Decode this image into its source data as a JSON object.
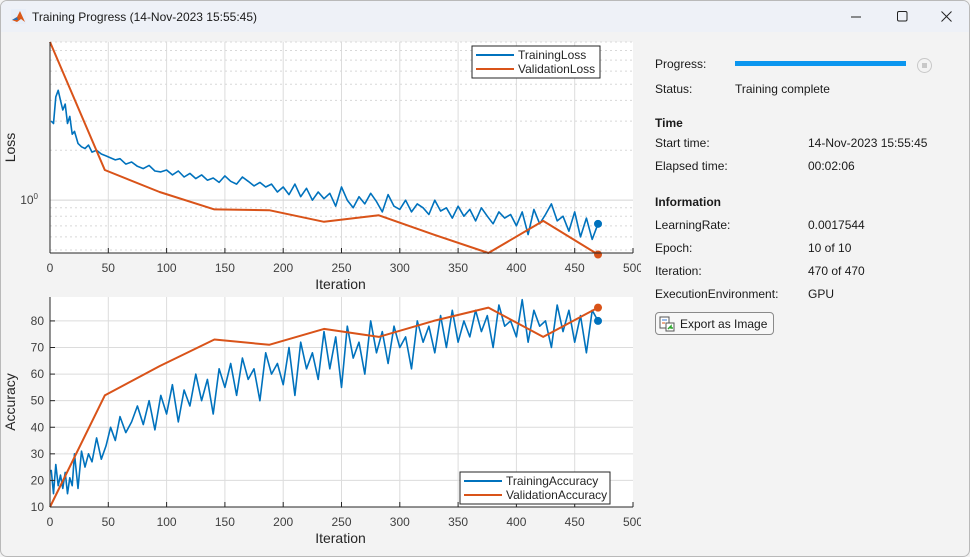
{
  "window": {
    "title": "Training Progress (14-Nov-2023 15:55:45)",
    "controls": [
      "minimize",
      "maximize",
      "close"
    ]
  },
  "panel": {
    "progress_label": "Progress:",
    "progress_fraction": 1.0,
    "status_label": "Status:",
    "status_value": "Training complete",
    "time_heading": "Time",
    "start_time_label": "Start time:",
    "start_time_value": "14-Nov-2023 15:55:45",
    "elapsed_label": "Elapsed time:",
    "elapsed_value": "00:02:06",
    "info_heading": "Information",
    "learning_rate_label": "LearningRate:",
    "learning_rate_value": "0.0017544",
    "epoch_label": "Epoch:",
    "epoch_value": "10 of 10",
    "iteration_label": "Iteration:",
    "iteration_value": "470 of 470",
    "exec_env_label": "ExecutionEnvironment:",
    "exec_env_value": "GPU",
    "export_button_label": "Export as Image"
  },
  "chart_data": [
    {
      "type": "line",
      "title": "",
      "xlabel": "Iteration",
      "ylabel": "Loss",
      "yscale": "log",
      "xlim": [
        0,
        500
      ],
      "ylim": [
        0.48,
        9
      ],
      "xticks": [
        0,
        50,
        100,
        150,
        200,
        250,
        300,
        350,
        400,
        450,
        500
      ],
      "yticks": [
        {
          "value": 1,
          "label": "10",
          "sup": "0"
        }
      ],
      "grid": true,
      "legend": {
        "position": "top-right",
        "entries": [
          "TrainingLoss",
          "ValidationLoss"
        ]
      },
      "series": [
        {
          "name": "TrainingLoss",
          "color": "#0072bd",
          "x": [
            1,
            3,
            5,
            7,
            9,
            11,
            13,
            15,
            17,
            19,
            21,
            24,
            27,
            30,
            33,
            36,
            40,
            44,
            48,
            52,
            56,
            60,
            65,
            70,
            75,
            80,
            85,
            90,
            95,
            100,
            105,
            110,
            115,
            120,
            125,
            130,
            135,
            140,
            145,
            150,
            155,
            160,
            165,
            170,
            175,
            180,
            185,
            190,
            195,
            200,
            205,
            210,
            215,
            220,
            225,
            230,
            235,
            240,
            245,
            250,
            255,
            260,
            265,
            270,
            275,
            280,
            285,
            290,
            295,
            300,
            305,
            310,
            315,
            320,
            325,
            330,
            335,
            340,
            345,
            350,
            355,
            360,
            365,
            370,
            375,
            380,
            385,
            390,
            395,
            400,
            405,
            410,
            415,
            420,
            425,
            430,
            435,
            440,
            445,
            450,
            455,
            460,
            465,
            470
          ],
          "y": [
            3.0,
            2.9,
            4.2,
            4.6,
            4.0,
            3.5,
            3.8,
            2.9,
            3.2,
            2.5,
            2.6,
            2.2,
            2.1,
            2.05,
            2.15,
            1.95,
            2.0,
            1.9,
            1.85,
            1.8,
            1.75,
            1.78,
            1.65,
            1.7,
            1.6,
            1.55,
            1.62,
            1.5,
            1.48,
            1.52,
            1.42,
            1.5,
            1.38,
            1.45,
            1.35,
            1.42,
            1.32,
            1.36,
            1.28,
            1.4,
            1.3,
            1.25,
            1.38,
            1.3,
            1.22,
            1.28,
            1.2,
            1.25,
            1.12,
            1.2,
            1.08,
            1.25,
            1.05,
            1.18,
            1.0,
            1.12,
            1.02,
            1.1,
            0.92,
            1.2,
            1.0,
            0.9,
            1.05,
            0.95,
            1.1,
            0.98,
            0.85,
            1.08,
            0.92,
            0.88,
            1.0,
            0.85,
            0.95,
            0.9,
            0.82,
            1.0,
            0.86,
            0.9,
            0.78,
            0.92,
            0.8,
            0.88,
            0.75,
            0.9,
            0.8,
            0.72,
            0.85,
            0.78,
            0.82,
            0.7,
            0.85,
            0.62,
            0.88,
            0.72,
            0.82,
            0.95,
            0.75,
            0.8,
            0.65,
            0.85,
            0.6,
            0.78,
            0.58,
            0.72
          ]
        },
        {
          "name": "ValidationLoss",
          "color": "#d95319",
          "x": [
            0,
            47,
            94,
            141,
            188,
            235,
            282,
            329,
            376,
            423,
            470
          ],
          "y": [
            9.0,
            1.52,
            1.12,
            0.88,
            0.87,
            0.74,
            0.81,
            0.62,
            0.48,
            0.75,
            0.47
          ]
        }
      ]
    },
    {
      "type": "line",
      "title": "",
      "xlabel": "Iteration",
      "ylabel": "Accuracy",
      "xlim": [
        0,
        500
      ],
      "ylim": [
        10,
        89
      ],
      "xticks": [
        0,
        50,
        100,
        150,
        200,
        250,
        300,
        350,
        400,
        450,
        500
      ],
      "yticks": [
        10,
        20,
        30,
        40,
        50,
        60,
        70,
        80
      ],
      "grid": true,
      "legend": {
        "position": "bottom-right",
        "entries": [
          "TrainingAccuracy",
          "ValidationAccuracy"
        ]
      },
      "series": [
        {
          "name": "TrainingAccuracy",
          "color": "#0072bd",
          "x": [
            1,
            3,
            5,
            7,
            9,
            11,
            13,
            15,
            17,
            19,
            21,
            24,
            27,
            30,
            33,
            36,
            40,
            44,
            48,
            52,
            56,
            60,
            65,
            70,
            75,
            80,
            85,
            90,
            95,
            100,
            105,
            110,
            115,
            120,
            125,
            130,
            135,
            140,
            145,
            150,
            155,
            160,
            165,
            170,
            175,
            180,
            185,
            190,
            195,
            200,
            205,
            210,
            215,
            220,
            225,
            230,
            235,
            240,
            245,
            250,
            255,
            260,
            265,
            270,
            275,
            280,
            285,
            290,
            295,
            300,
            305,
            310,
            315,
            320,
            325,
            330,
            335,
            340,
            345,
            350,
            355,
            360,
            365,
            370,
            375,
            380,
            385,
            390,
            395,
            400,
            405,
            410,
            415,
            420,
            425,
            430,
            435,
            440,
            445,
            450,
            455,
            460,
            465,
            470
          ],
          "y": [
            24,
            15,
            26,
            18,
            22,
            17,
            23,
            15,
            21,
            18,
            30,
            17,
            31,
            25,
            30,
            27,
            36,
            28,
            33,
            40,
            35,
            44,
            38,
            42,
            48,
            41,
            50,
            39,
            52,
            45,
            56,
            42,
            54,
            48,
            60,
            50,
            58,
            45,
            62,
            55,
            64,
            52,
            66,
            58,
            62,
            50,
            68,
            60,
            64,
            56,
            70,
            52,
            72,
            62,
            68,
            58,
            76,
            62,
            74,
            55,
            78,
            66,
            72,
            60,
            80,
            68,
            76,
            64,
            78,
            70,
            74,
            62,
            80,
            72,
            78,
            68,
            82,
            70,
            84,
            72,
            80,
            74,
            84,
            76,
            82,
            70,
            86,
            78,
            80,
            74,
            88,
            72,
            84,
            78,
            80,
            70,
            86,
            76,
            84,
            72,
            82,
            68,
            84,
            80
          ]
        },
        {
          "name": "ValidationAccuracy",
          "color": "#d95319",
          "x": [
            0,
            47,
            94,
            141,
            188,
            235,
            282,
            329,
            376,
            423,
            470
          ],
          "y": [
            10,
            52,
            63,
            73,
            71,
            77,
            74,
            80,
            85,
            74,
            85
          ]
        }
      ]
    }
  ]
}
